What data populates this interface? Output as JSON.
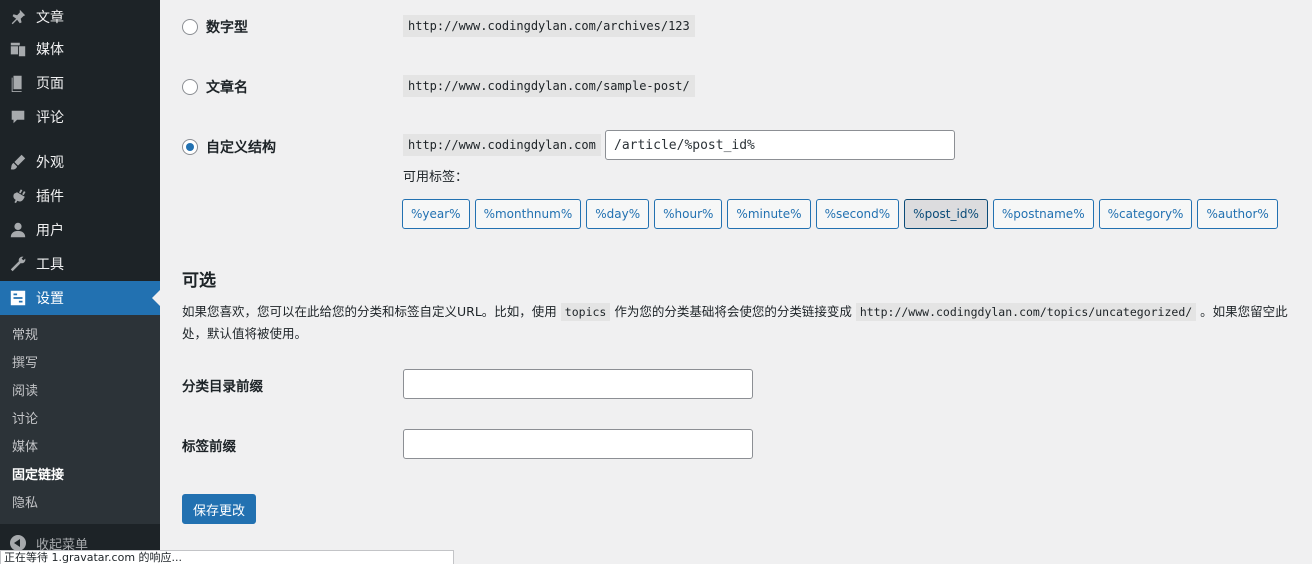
{
  "sidebar": {
    "items": [
      {
        "label": "文章",
        "icon": "pin-icon"
      },
      {
        "label": "媒体",
        "icon": "media-icon"
      },
      {
        "label": "页面",
        "icon": "page-icon"
      },
      {
        "label": "评论",
        "icon": "comment-icon"
      },
      {
        "label": "外观",
        "icon": "brush-icon"
      },
      {
        "label": "插件",
        "icon": "plugin-icon"
      },
      {
        "label": "用户",
        "icon": "user-icon"
      },
      {
        "label": "工具",
        "icon": "wrench-icon"
      },
      {
        "label": "设置",
        "icon": "settings-icon"
      }
    ],
    "submenu": [
      "常规",
      "撰写",
      "阅读",
      "讨论",
      "媒体",
      "固定链接",
      "隐私"
    ],
    "collapse_label": "收起菜单"
  },
  "permalink": {
    "options": [
      {
        "label": "数字型",
        "example": "http://www.codingdylan.com/archives/123",
        "checked": false
      },
      {
        "label": "文章名",
        "example": "http://www.codingdylan.com/sample-post/",
        "checked": false
      },
      {
        "label": "自定义结构",
        "example": "http://www.codingdylan.com",
        "checked": true
      }
    ],
    "custom_value": "/article/%post_id%",
    "available_tags_label": "可用标签：",
    "tags": [
      "%year%",
      "%monthnum%",
      "%day%",
      "%hour%",
      "%minute%",
      "%second%",
      "%post_id%",
      "%postname%",
      "%category%",
      "%author%"
    ],
    "active_tag": "%post_id%"
  },
  "optional": {
    "title": "可选",
    "desc_part1": "如果您喜欢，您可以在此给您的分类和标签自定义URL。比如，使用",
    "desc_code1": "topics",
    "desc_part2": "作为您的分类基础将会使您的分类链接变成",
    "desc_code2": "http://www.codingdylan.com/topics/uncategorized/",
    "desc_part3": "。如果您留空此",
    "desc_line2": "处，默认值将被使用。",
    "category_base_label": "分类目录前缀",
    "category_base_value": "",
    "tag_base_label": "标签前缀",
    "tag_base_value": ""
  },
  "save_label": "保存更改",
  "status_text": "正在等待 1.gravatar.com 的响应..."
}
